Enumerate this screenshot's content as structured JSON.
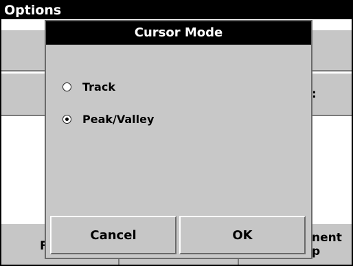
{
  "window": {
    "title": "Options"
  },
  "background": {
    "row2_fragment": ":",
    "bottom_left_fragment": "F",
    "bottom_right_line1": "nent",
    "bottom_right_line2": "p"
  },
  "dialog": {
    "title": "Cursor Mode",
    "options": [
      {
        "label": "Track",
        "selected": false
      },
      {
        "label": "Peak/Valley",
        "selected": true
      }
    ],
    "cancel_label": "Cancel",
    "ok_label": "OK"
  }
}
